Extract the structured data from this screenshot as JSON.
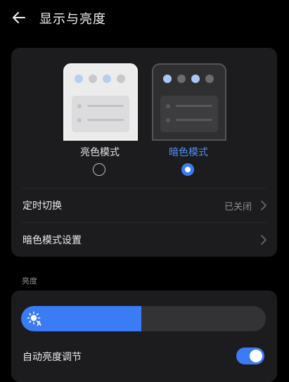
{
  "header": {
    "title": "显示与亮度",
    "back_icon": "arrow-left-icon"
  },
  "theme": {
    "light_label": "亮色模式",
    "dark_label": "暗色模式",
    "selected": "dark",
    "accent_color": "#3b7cf6"
  },
  "rows": [
    {
      "label": "定时切换",
      "value": "已关闭"
    },
    {
      "label": "暗色模式设置",
      "value": ""
    }
  ],
  "brightness": {
    "section_label": "亮度",
    "level": 0.49,
    "auto_label": "自动亮度调节",
    "auto_enabled": true
  }
}
